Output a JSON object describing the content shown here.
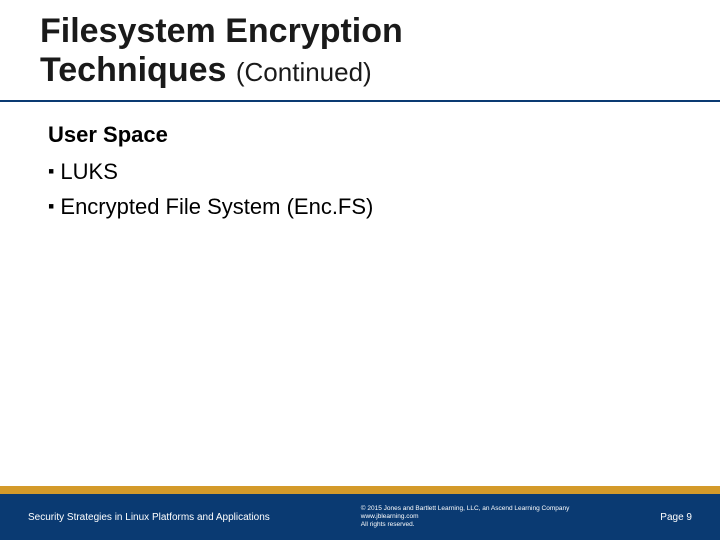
{
  "title": {
    "main_line1": "Filesystem Encryption",
    "main_line2": "Techniques",
    "suffix": "(Continued)"
  },
  "content": {
    "subhead": "User Space",
    "bullets": [
      "LUKS",
      "Encrypted File System (Enc.FS)"
    ]
  },
  "footer": {
    "left": "Security Strategies in Linux Platforms and Applications",
    "center_line1": "© 2015 Jones and Bartlett Learning, LLC, an Ascend Learning Company",
    "center_line2": "www.jblearning.com",
    "center_line3": "All rights reserved.",
    "right": "Page 9"
  },
  "colors": {
    "blue": "#0a3a72",
    "gold": "#d49a2a"
  }
}
